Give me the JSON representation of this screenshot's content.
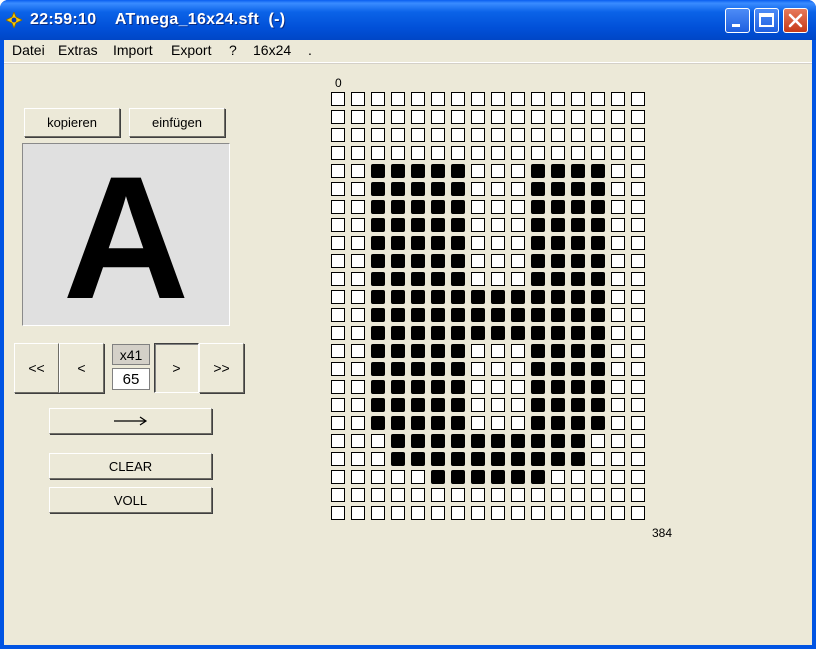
{
  "titlebar": {
    "title": "22:59:10    ATmega_16x24.sft  (-)",
    "icon": "yellow-gear-icon",
    "minimize_icon": "minimize-icon",
    "maximize_icon": "maximize-icon",
    "close_icon": "close-icon"
  },
  "menu": {
    "items": [
      "Datei",
      "Extras",
      "Import",
      "Export",
      "?",
      "16x24",
      "."
    ]
  },
  "controls": {
    "copy_label": "kopieren",
    "paste_label": "einfügen",
    "first_label": "<<",
    "prev_label": "<",
    "next_label": ">",
    "last_label": ">>",
    "hex_value": "x41",
    "dec_value": "65",
    "arrow_label": "—›",
    "clear_label": "CLEAR",
    "fill_label": "VOLL"
  },
  "preview": {
    "character": "A"
  },
  "grid": {
    "start_index": "0",
    "end_index": "384",
    "columns": 16,
    "rows": [
      "0000000000000000",
      "0000000000000000",
      "0000000000000000",
      "0000000000000000",
      "0011111000111100",
      "0011111000111100",
      "0011111000111100",
      "0011111000111100",
      "0011111000111100",
      "0011111000111100",
      "0011111000111100",
      "0011111111111100",
      "0011111111111100",
      "0011111111111100",
      "0011111000111100",
      "0011111000111100",
      "0011111000111100",
      "0011111000111100",
      "0011111000111100",
      "0001111111111000",
      "0001111111111000",
      "0000011111100000",
      "0000000000000000",
      "0000000000000000"
    ]
  },
  "colors": {
    "titlebar": "#0054e3",
    "face": "#ece9d8",
    "pixel_on": "#000000",
    "pixel_off": "#ffffff"
  }
}
